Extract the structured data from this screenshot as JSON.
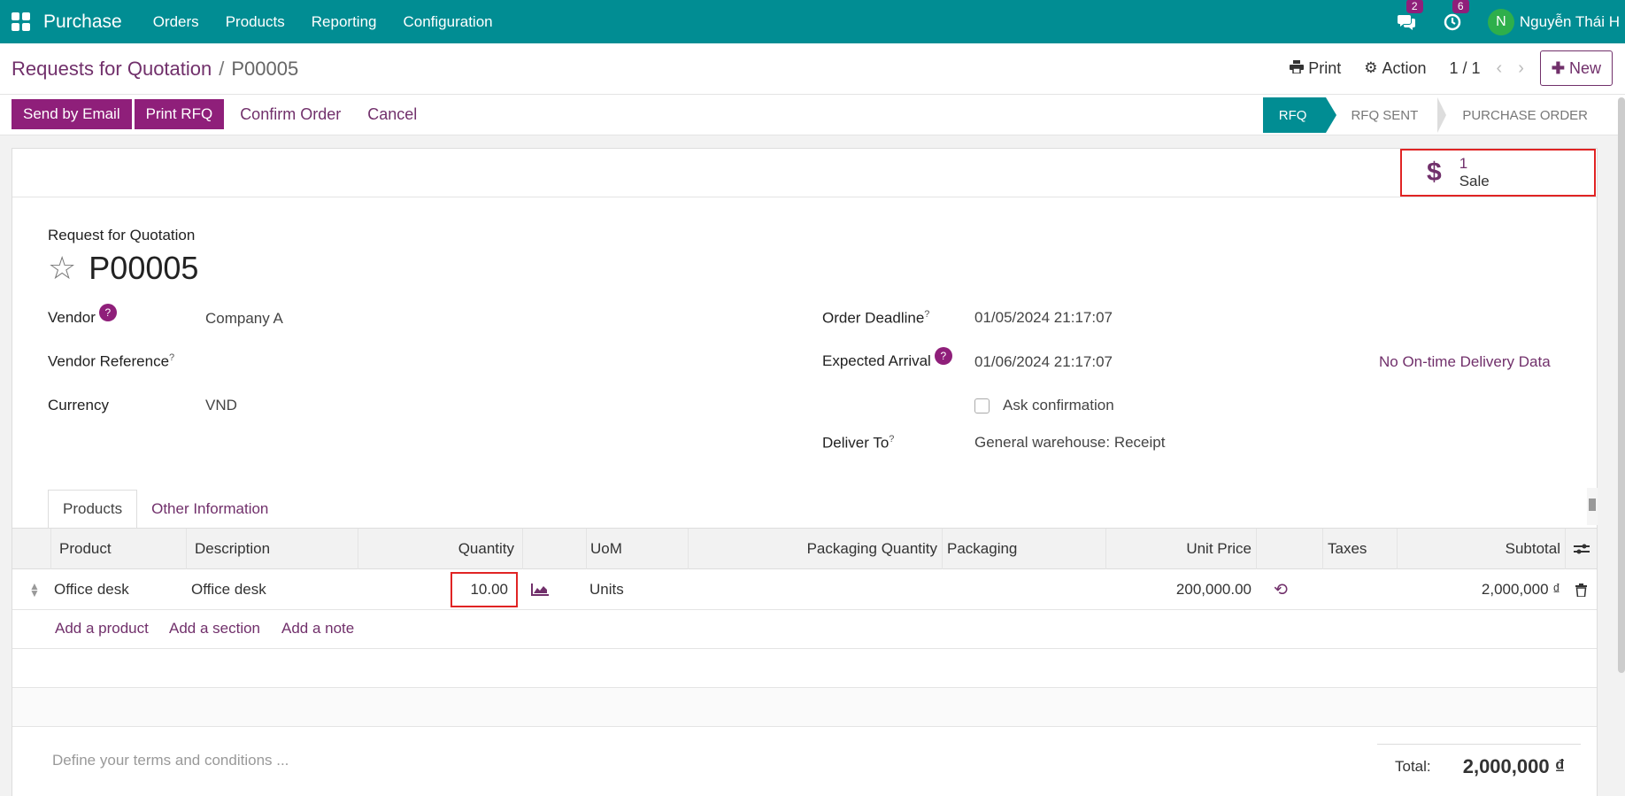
{
  "navbar": {
    "app_name": "Purchase",
    "menu": [
      "Orders",
      "Products",
      "Reporting",
      "Configuration"
    ],
    "chat_count": "2",
    "activity_count": "6",
    "avatar_initial": "N",
    "user_name": "Nguyễn Thái H"
  },
  "control_panel": {
    "breadcrumb_parent": "Requests for Quotation",
    "breadcrumb_separator": "/",
    "breadcrumb_current": "P00005",
    "print_label": "Print",
    "action_label": "Action",
    "pager": "1 / 1",
    "new_label": "New"
  },
  "statusbar": {
    "buttons": [
      "Send by Email",
      "Print RFQ",
      "Confirm Order",
      "Cancel"
    ],
    "stages": [
      "RFQ",
      "RFQ SENT",
      "PURCHASE ORDER"
    ],
    "active_stage": "RFQ"
  },
  "smart_button": {
    "icon": "dollar-icon",
    "value": "1",
    "label": "Sale"
  },
  "form": {
    "subtitle": "Request for Quotation",
    "title": "P00005",
    "vendor_label": "Vendor",
    "vendor_value": "Company A",
    "vendor_ref_label": "Vendor Reference",
    "currency_label": "Currency",
    "currency_value": "VND",
    "order_deadline_label": "Order Deadline",
    "order_deadline_value": "01/05/2024 21:17:07",
    "expected_arrival_label": "Expected Arrival",
    "expected_arrival_value": "01/06/2024 21:17:07",
    "on_time_label": "No On-time Delivery Data",
    "ask_confirmation_label": "Ask confirmation",
    "deliver_to_label": "Deliver To",
    "deliver_to_value": "General warehouse: Receipt",
    "help_mark": "?",
    "tooltip_mark": "?"
  },
  "tabs": [
    "Products",
    "Other Information"
  ],
  "table": {
    "headers": [
      "Product",
      "Description",
      "Quantity",
      "UoM",
      "Packaging Quantity",
      "Packaging",
      "Unit Price",
      "Taxes",
      "Subtotal"
    ],
    "rows": [
      {
        "product": "Office desk",
        "description": "Office desk",
        "quantity": "10.00",
        "uom": "Units",
        "unit_price": "200,000.00",
        "subtotal": "2,000,000 ₫"
      }
    ],
    "add_links": [
      "Add a product",
      "Add a section",
      "Add a note"
    ]
  },
  "footer": {
    "terms_placeholder": "Define your terms and conditions ...",
    "total_label": "Total:",
    "total_value": "2,000,000 ₫"
  },
  "colors": {
    "navbar": "#018d93",
    "primary": "#8f1f7a",
    "link": "#71306b",
    "highlight": "#e02424"
  }
}
